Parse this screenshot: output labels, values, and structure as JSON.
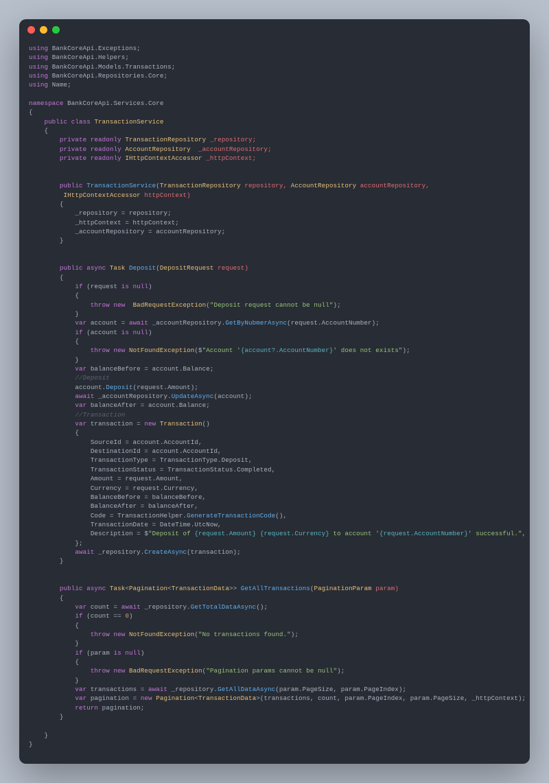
{
  "window": {
    "close": "close",
    "minimize": "minimize",
    "maximize": "maximize"
  },
  "code": {
    "u1a": "using",
    "u1b": " BankCoreApi.Exceptions;",
    "u2a": "using",
    "u2b": " BankCoreApi.Helpers;",
    "u3a": "using",
    "u3b": " BankCoreApi.Models.Transactions;",
    "u4a": "using",
    "u4b": " BankCoreApi.Repositories.Core;",
    "u5a": "using",
    "u5b": " Name;",
    "nsKw": "namespace",
    "ns": " BankCoreApi.Services.Core",
    "obr": "{",
    "cbr": "}",
    "obr2": "    {",
    "cbr2": "    }",
    "clsKw": "    public class ",
    "clsName": "TransactionService",
    "f1": "        private readonly ",
    "f1t": "TransactionRepository",
    "f1n": " _repository;",
    "f2": "        private readonly ",
    "f2t": "AccountRepository",
    "f2n": "  _accountRepository;",
    "f3": "        private readonly ",
    "f3t": "IHttpContextAccessor",
    "f3n": " _httpContext;",
    "ctor1": "        public ",
    "ctorName": "TransactionService",
    "ctorArgs1": "(",
    "ctorT1": "TransactionRepository",
    "ctorP1": " repository, ",
    "ctorT2": "AccountRepository",
    "ctorP2": " accountRepository,",
    "ctor2a": "         ",
    "ctorT3": "IHttpContextAccessor",
    "ctorP3": " httpContext)",
    "ctor3": "        {",
    "ctor4": "            _repository = repository;",
    "ctor5": "            _httpContext = httpContext;",
    "ctor6": "            _accountRepository = accountRepository;",
    "ctor7": "        }",
    "m1sig1": "        public async ",
    "m1Task": "Task ",
    "m1Name": "Deposit",
    "m1Args": "(",
    "m1T1": "DepositRequest",
    "m1P1": " request)",
    "m1ob": "        {",
    "m1l1a": "            if",
    "m1l1b": " (request ",
    "m1l1c": "is null",
    "m1l1d": ")",
    "m1l2": "            {",
    "m1l3a": "                throw new  ",
    "m1l3b": "BadRequestException",
    "m1l3c": "(",
    "m1l3d": "\"Deposit request cannot be null\"",
    "m1l3e": ");",
    "m1l4": "            }",
    "m1l5a": "            var",
    "m1l5b": " account = ",
    "m1l5c": "await",
    "m1l5d": " _accountRepository.",
    "m1l5e": "GetByNubmerAsync",
    "m1l5f": "(request.AccountNumber);",
    "m1l6a": "            if",
    "m1l6b": " (account ",
    "m1l6c": "is null",
    "m1l6d": ")",
    "m1l7": "            {",
    "m1l8a": "                throw new ",
    "m1l8b": "NotFoundException",
    "m1l8c": "($",
    "m1l8d": "\"Account '",
    "m1l8e": "{account?.AccountNumber}",
    "m1l8f": "' does not exists\"",
    "m1l8g": ");",
    "m1l9": "            }",
    "m1l10a": "            var",
    "m1l10b": " balanceBefore = account.Balance;",
    "m1l11": "            //Deposit",
    "m1l12": "            account.",
    "m1l12b": "Deposit",
    "m1l12c": "(request.Amount);",
    "m1l13a": "            await",
    "m1l13b": " _accountRepository.",
    "m1l13c": "UpdateAsync",
    "m1l13d": "(account);",
    "m1l14a": "            var",
    "m1l14b": " balanceAfter = account.Balance;",
    "m1l15": "            //Transaction",
    "m1l16a": "            var",
    "m1l16b": " transaction = ",
    "m1l16c": "new ",
    "m1l16d": "Transaction",
    "m1l16e": "()",
    "m1l17": "            {",
    "m1l18": "                SourceId = account.AccountId,",
    "m1l19": "                DestinationId = account.AccountId,",
    "m1l20": "                TransactionType = TransactionType.Deposit,",
    "m1l21": "                TransactionStatus = TransactionStatus.Completed,",
    "m1l22": "                Amount = request.Amount,",
    "m1l23": "                Currency = request.Currency,",
    "m1l24": "                BalanceBefore = balanceBefore,",
    "m1l25": "                BalanceAfter = balanceAfter,",
    "m1l26": "                Code = TransactionHelper.",
    "m1l26b": "GenerateTransactionCode",
    "m1l26c": "(),",
    "m1l27": "                TransactionDate = DateTime.UtcNow,",
    "m1l28a": "                Description = $",
    "m1l28b": "\"Deposit of ",
    "m1l28c": "{request.Amount}",
    "m1l28d": " ",
    "m1l28e": "{request.Currency}",
    "m1l28f": " to account '",
    "m1l28g": "{request.AccountNumber}",
    "m1l28h": "' successful.\"",
    "m1l28i": ",",
    "m1l29": "            };",
    "m1l30a": "            await",
    "m1l30b": " _repository.",
    "m1l30c": "CreateAsync",
    "m1l30d": "(transaction);",
    "m1cb": "        }",
    "m2sig1": "        public async ",
    "m2Task": "Task",
    "m2gen1": "<",
    "m2T1": "Pagination",
    "m2gen2": "<",
    "m2T2": "TransactionData",
    "m2gen3": ">> ",
    "m2Name": "GetAllTransactions",
    "m2Args": "(",
    "m2PT": "PaginationParam",
    "m2PN": " param)",
    "m2ob": "        {",
    "m2l1a": "            var",
    "m2l1b": " count = ",
    "m2l1c": "await",
    "m2l1d": " _repository.",
    "m2l1e": "GetTotalDataAsync",
    "m2l1f": "();",
    "m2l2a": "            if",
    "m2l2b": " (count == ",
    "m2l2c": "0",
    "m2l2d": ")",
    "m2l3": "            {",
    "m2l4a": "                throw new ",
    "m2l4b": "NotFoundException",
    "m2l4c": "(",
    "m2l4d": "\"No transactions found.\"",
    "m2l4e": ");",
    "m2l5": "            }",
    "m2l6a": "            if",
    "m2l6b": " (param ",
    "m2l6c": "is null",
    "m2l6d": ")",
    "m2l7": "            {",
    "m2l8a": "                throw new ",
    "m2l8b": "BadRequestException",
    "m2l8c": "(",
    "m2l8d": "\"Pagination params cannot be null\"",
    "m2l8e": ");",
    "m2l9": "            }",
    "m2l10a": "            var",
    "m2l10b": " transactions = ",
    "m2l10c": "await",
    "m2l10d": " _repository.",
    "m2l10e": "GetAllDataAsync",
    "m2l10f": "(param.PageSize, param.PageIndex);",
    "m2l11a": "            var",
    "m2l11b": " pagination = ",
    "m2l11c": "new ",
    "m2l11d": "Pagination",
    "m2l11e": "<",
    "m2l11f": "TransactionData",
    "m2l11g": ">(transactions, count, param.PageIndex, param.PageSize, _httpContext);",
    "m2l12a": "            return",
    "m2l12b": " pagination;",
    "m2cb": "        }"
  }
}
